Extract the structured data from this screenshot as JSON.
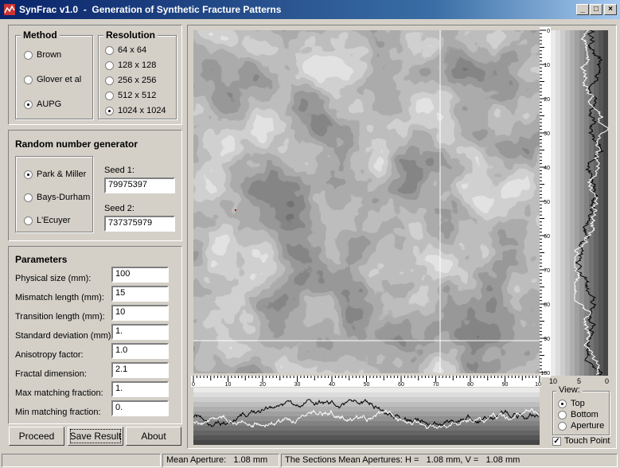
{
  "window": {
    "title": "SynFrac v1.0  -  Generation of Synthetic Fracture Patterns",
    "controls": {
      "minimize": "_",
      "maximize": "□",
      "close": "×"
    }
  },
  "method": {
    "legend": "Method",
    "options": [
      "Brown",
      "Glover et al",
      "AUPG"
    ],
    "selected": "AUPG"
  },
  "resolution": {
    "legend": "Resolution",
    "options": [
      "64 x 64",
      "128 x 128",
      "256 x 256",
      "512 x 512",
      "1024 x 1024"
    ],
    "selected": "1024 x 1024"
  },
  "rng": {
    "title": "Random number generator",
    "options": [
      "Park & Miller",
      "Bays-Durham",
      "L'Ecuyer"
    ],
    "selected": "Park & Miller",
    "seed1_label": "Seed 1:",
    "seed1": "79975397",
    "seed2_label": "Seed 2:",
    "seed2": "737375979"
  },
  "parameters": {
    "title": "Parameters",
    "fields": [
      {
        "label": "Physical size (mm):",
        "value": "100"
      },
      {
        "label": "Mismatch length (mm):",
        "value": "15"
      },
      {
        "label": "Transition length (mm):",
        "value": "10"
      },
      {
        "label": "Standard deviation (mm):",
        "value": "1."
      },
      {
        "label": "Anisotropy factor:",
        "value": "1.0"
      },
      {
        "label": "Fractal dimension:",
        "value": "2.1"
      },
      {
        "label": "Max matching fraction:",
        "value": "1."
      },
      {
        "label": "Min matching fraction:",
        "value": "0."
      }
    ]
  },
  "buttons": {
    "proceed": "Proceed",
    "save": "Save Result",
    "about": "About"
  },
  "view": {
    "legend": "View:",
    "options": [
      "Top",
      "Bottom",
      "Aperture"
    ],
    "selected": "Top",
    "touch_point_label": "Touch Point",
    "touch_point_checked": true
  },
  "ruler_right": {
    "ticks": [
      "0",
      "10",
      "20",
      "30",
      "40",
      "50",
      "60",
      "70",
      "80",
      "90",
      "100"
    ]
  },
  "ruler_bottom": {
    "ticks": [
      "0",
      "10",
      "20",
      "30",
      "40",
      "50",
      "60",
      "70",
      "80",
      "90",
      "100"
    ]
  },
  "scale_labels": {
    "left": "10",
    "mid": "5",
    "right": "0"
  },
  "status": {
    "mean_aperture": "Mean Aperture:   1.08 mm",
    "sections": "The Sections Mean Apertures: H =   1.08 mm, V =   1.08 mm"
  },
  "colors": {
    "titlebar": "#0a246a",
    "face": "#d4d0c8"
  }
}
